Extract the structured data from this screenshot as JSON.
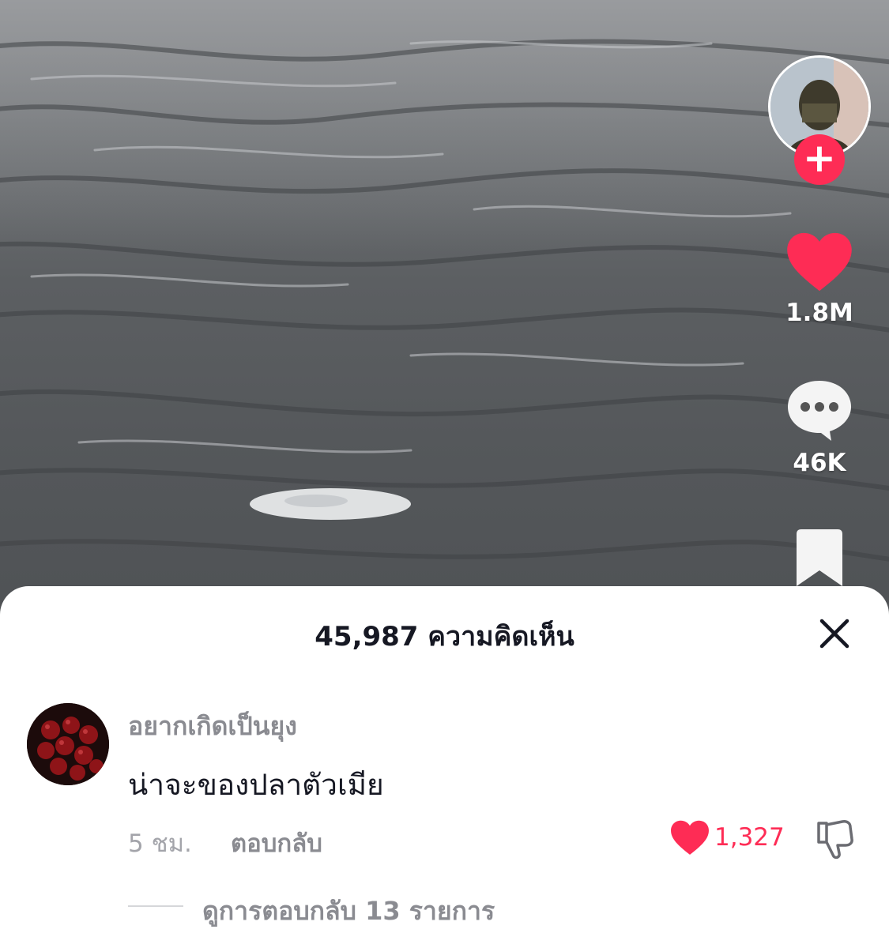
{
  "video": {
    "creator_avatar_icon": "creator-avatar",
    "follow_icon": "plus-icon",
    "like_icon": "heart-icon",
    "like_count": "1.8M",
    "comment_icon": "chat-bubble-icon",
    "comment_count": "46K",
    "save_icon": "bookmark-icon"
  },
  "comments_sheet": {
    "title": "45,987 ความคิดเห็น",
    "close_icon": "close-icon",
    "comments": [
      {
        "username": "อยากเกิดเป็นยุง",
        "text": "น่าจะของปลาตัวเมีย",
        "time": "5 ชม.",
        "reply_label": "ตอบกลับ",
        "like_count": "1,327",
        "liked": true,
        "view_replies": "ดูการตอบกลับ 13 รายการ"
      }
    ]
  },
  "colors": {
    "accent": "#fe2c55",
    "text_primary": "#161823",
    "text_secondary": "#8a8b91"
  }
}
